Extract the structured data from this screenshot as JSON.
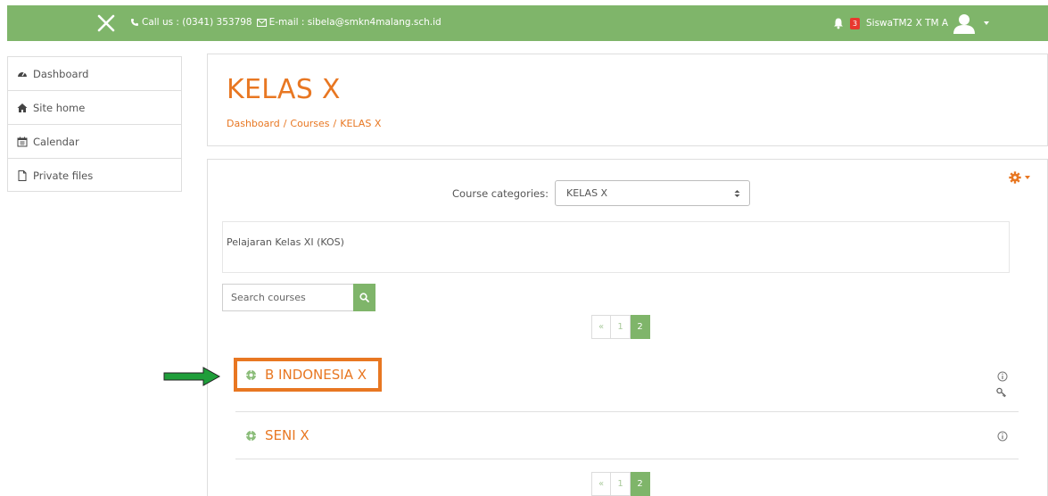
{
  "topbar": {
    "contact_text": "Call us : (0341) 353798",
    "email_text": "E-mail : sibela@smkn4malang.sch.id",
    "notification_count": "3",
    "user_name": "SiswaTM2 X TM A"
  },
  "sidebar": {
    "items": [
      {
        "label": "Dashboard",
        "icon": "tachometer-icon"
      },
      {
        "label": "Site home",
        "icon": "home-icon"
      },
      {
        "label": "Calendar",
        "icon": "calendar-icon"
      },
      {
        "label": "Private files",
        "icon": "file-icon"
      }
    ]
  },
  "header": {
    "title": "KELAS X",
    "breadcrumb": [
      "Dashboard",
      "Courses",
      "KELAS X"
    ]
  },
  "main": {
    "category_label": "Course categories:",
    "category_selected": "KELAS X",
    "subcategory": "Pelajaran Kelas XI (KOS)",
    "search_placeholder": "Search courses",
    "pager": [
      "«",
      "1",
      "2"
    ],
    "active_page": "2",
    "courses": [
      {
        "name": "B INDONESIA X",
        "highlighted": true
      },
      {
        "name": "SENI X",
        "highlighted": false
      }
    ]
  },
  "colors": {
    "accent": "#e87722",
    "topbar": "#7fb56a",
    "highlight_arrow": "#1f9e3a"
  }
}
